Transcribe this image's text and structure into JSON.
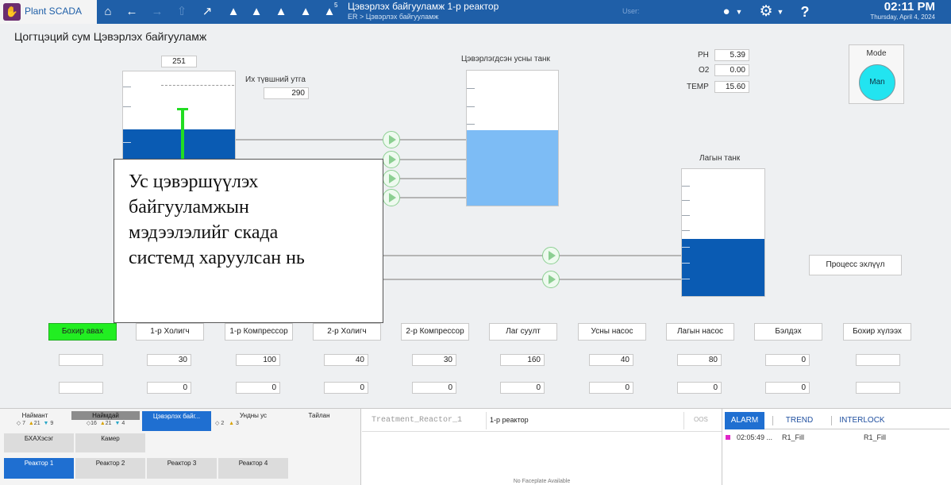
{
  "app": {
    "name": "Plant SCADA",
    "logo_glyph": "✋"
  },
  "topbar": {
    "title": "Цэвэрлэх байгууламж 1-р реактор",
    "breadcrumb": "ER > Цэвэрлэх байгууламж",
    "user_label": "User:",
    "time": "02:11 PM",
    "date": "Thursday, April 4, 2024",
    "icons": {
      "home": "⌂",
      "back": "←",
      "forward": "→",
      "up": "⇧",
      "trend": "↗",
      "alarm": "▲",
      "alarm_ack": "▲",
      "alarm_clear": "▲",
      "alarm_silence": "▲",
      "alarm_count": "▲",
      "user": "●",
      "gear": "⚙",
      "help": "?"
    },
    "alarm_count_badge": "5"
  },
  "page": {
    "title": "Цогтцэций сум Цэвэрлэх байгууламж"
  },
  "reactor_tank": {
    "level_value": "251",
    "max_level_label": "Их түвшний утга",
    "max_level_value": "290",
    "fill_fraction": 0.38
  },
  "clean_water_tank": {
    "label": "Цэвэрлэгдсэн усны танк",
    "fill_fraction": 0.56
  },
  "sludge_tank": {
    "label": "Лагын танк",
    "fill_fraction": 0.45
  },
  "analyzer": {
    "ph_label": "PH",
    "ph_value": "5.39",
    "o2_label": "O2",
    "o2_value": "0.00",
    "temp_label": "TEMP",
    "temp_value": "15.60"
  },
  "mode": {
    "label": "Mode",
    "value": "Man",
    "color": "#22e4f0"
  },
  "process_button": {
    "label": "Процесс эхлүүл"
  },
  "overlay_caption": {
    "line1": "Ус цэвэршүүлэх",
    "line2": "байгууламжын",
    "line3": "мэдээлэлийг скада",
    "line4": "системд харуулсан нь"
  },
  "steps": [
    {
      "label": "Бохир авах",
      "set": "",
      "actual": "",
      "active": true
    },
    {
      "label": "1-р Холигч",
      "set": "30",
      "actual": "0"
    },
    {
      "label": "1-р Компрессор",
      "set": "100",
      "actual": "0"
    },
    {
      "label": "2-р Холигч",
      "set": "40",
      "actual": "0"
    },
    {
      "label": "2-р Компрессор",
      "set": "30",
      "actual": "0"
    },
    {
      "label": "Лаг суулт",
      "set": "160",
      "actual": "0"
    },
    {
      "label": "Усны насос",
      "set": "40",
      "actual": "0"
    },
    {
      "label": "Лагын насос",
      "set": "80",
      "actual": "0"
    },
    {
      "label": "Бэлдэх",
      "set": "0",
      "actual": "0"
    },
    {
      "label": "Бохир хүлээх",
      "set": "",
      "actual": ""
    }
  ],
  "nav": {
    "tabs": [
      {
        "label": "Наймант",
        "c1": "7",
        "c2": "21",
        "c3": "9"
      },
      {
        "label": "Наймдай",
        "c1": "16",
        "c2": "21",
        "c3": "4"
      },
      {
        "label": "Цэвэрлэх байг...",
        "c1": "",
        "c2": "",
        "c3": ""
      },
      {
        "label": "Ундны ус",
        "c1": "2",
        "c2": "3",
        "c3": ""
      },
      {
        "label": "Тайлан",
        "c1": "",
        "c2": "",
        "c3": ""
      }
    ],
    "row2": [
      "БХАХэсэг",
      "Камер"
    ],
    "reactors": [
      "Реактор 1",
      "Реактор 2",
      "Реактор 3",
      "Реактор 4"
    ]
  },
  "faceplate": {
    "tag": "Treatment_Reactor_1",
    "name": "1-р реактор",
    "status": "OOS",
    "empty_text": "No Faceplate Available"
  },
  "alarm_panel": {
    "tabs": [
      "ALARM",
      "TREND",
      "INTERLOCK"
    ],
    "rows": [
      {
        "time": "02:05:49 ...",
        "tag": "R1_Fill",
        "desc": "R1_Fill",
        "color": "#e026c8"
      }
    ]
  },
  "colors": {
    "topbar": "#1f5fa8",
    "tank_blue": "#0a5bb3",
    "water_blue": "#7dbcf5",
    "active_step": "#22ee22",
    "probe_green": "#22dd22"
  }
}
